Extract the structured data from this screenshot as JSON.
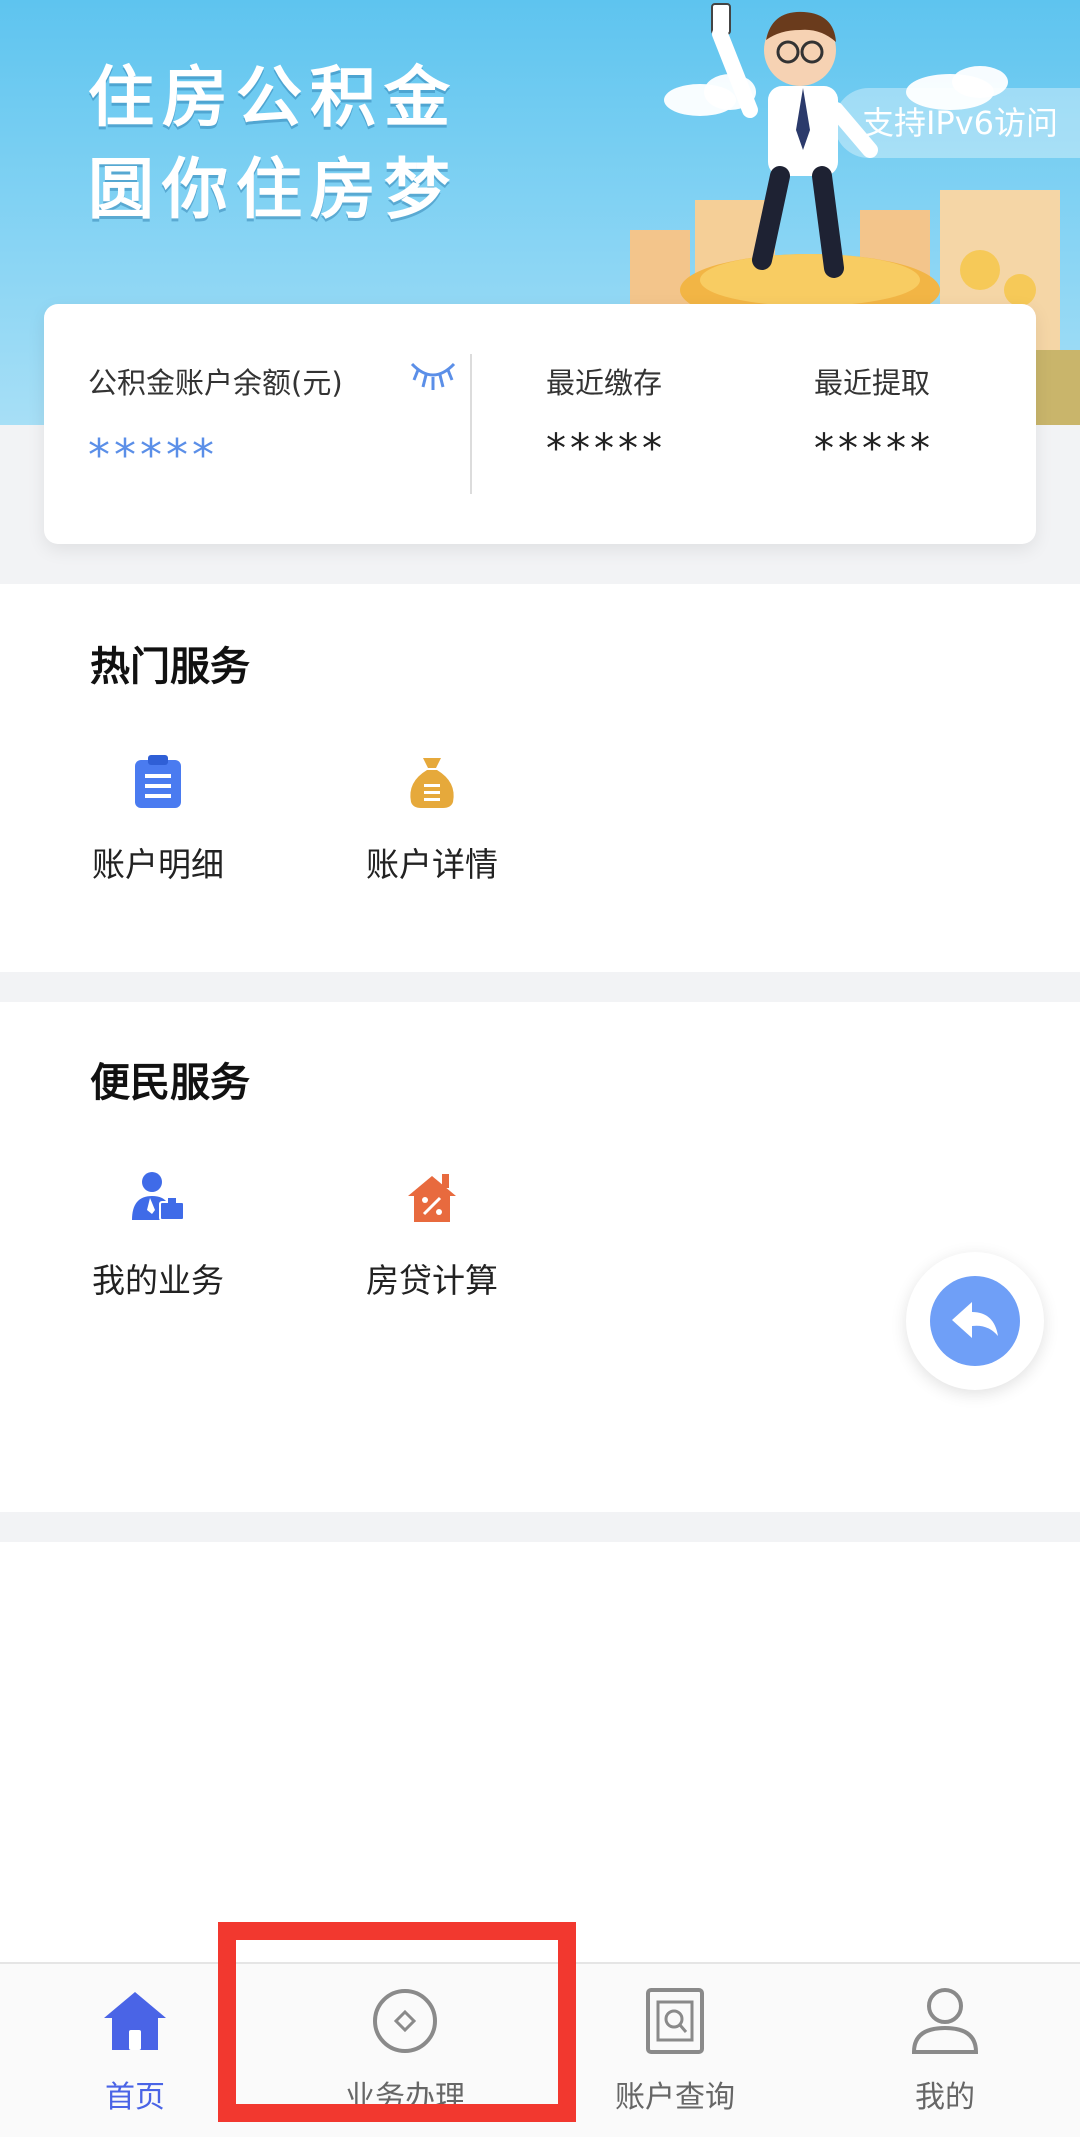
{
  "banner": {
    "title_line1": "住房公积金",
    "title_line2": "圆你住房梦",
    "ipv6_label": "支持IPv6访问"
  },
  "account_card": {
    "balance_label": "公积金账户余额(元)",
    "balance_value": "*****",
    "recent_deposit_label": "最近缴存",
    "recent_deposit_value": "*****",
    "recent_withdraw_label": "最近提取",
    "recent_withdraw_value": "*****",
    "eye_icon": "eye-closed-icon"
  },
  "hot_services": {
    "title": "热门服务",
    "items": [
      {
        "label": "账户明细",
        "icon": "clipboard-icon",
        "color": "#4a7bf0"
      },
      {
        "label": "账户详情",
        "icon": "money-bag-icon",
        "color": "#e6a93b"
      }
    ]
  },
  "convenience_services": {
    "title": "便民服务",
    "items": [
      {
        "label": "我的业务",
        "icon": "person-briefcase-icon",
        "color": "#3f6be8"
      },
      {
        "label": "房贷计算",
        "icon": "house-percent-icon",
        "color": "#e86a3e"
      }
    ]
  },
  "bottom_nav": {
    "items": [
      {
        "label": "首页",
        "icon": "home-icon",
        "active": true
      },
      {
        "label": "业务办理",
        "icon": "business-circle-icon",
        "active": false
      },
      {
        "label": "账户查询",
        "icon": "account-query-icon",
        "active": false
      },
      {
        "label": "我的",
        "icon": "profile-icon",
        "active": false
      }
    ]
  },
  "colors": {
    "accent": "#4a64e6",
    "highlight": "#f2382f",
    "banner_sky": "#5ec4ef"
  }
}
